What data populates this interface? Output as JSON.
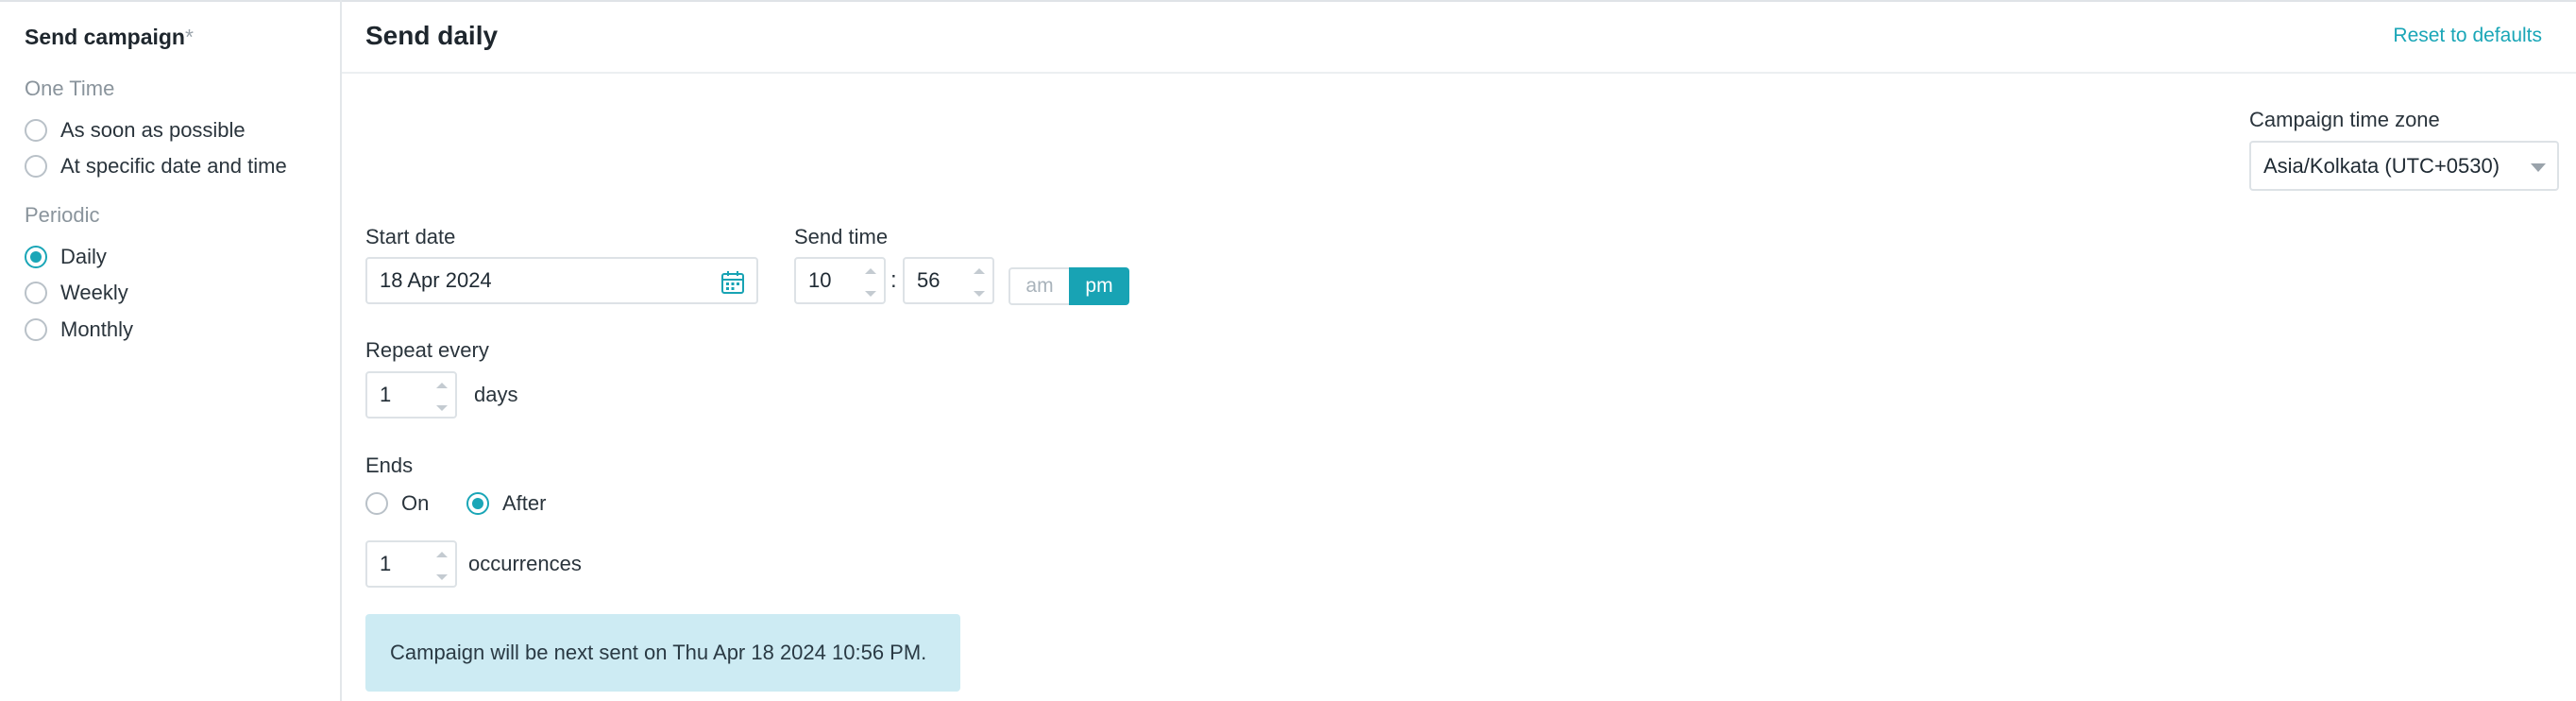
{
  "sidebar": {
    "title": "Send campaign",
    "required_mark": "*",
    "one_time_label": "One Time",
    "periodic_label": "Periodic",
    "options": [
      {
        "label": "As soon as possible",
        "selected": false
      },
      {
        "label": "At specific date and time",
        "selected": false
      },
      {
        "label": "Daily",
        "selected": true
      },
      {
        "label": "Weekly",
        "selected": false
      },
      {
        "label": "Monthly",
        "selected": false
      }
    ]
  },
  "header": {
    "title": "Send daily",
    "reset_label": "Reset to defaults"
  },
  "timezone": {
    "label": "Campaign time zone",
    "value": "Asia/Kolkata (UTC+0530)"
  },
  "start_date": {
    "label": "Start date",
    "value": "18 Apr 2024",
    "icon": "calendar-icon"
  },
  "send_time": {
    "label": "Send time",
    "hour": "10",
    "separator": ":",
    "minute": "56",
    "am_label": "am",
    "pm_label": "pm",
    "selected_period": "pm"
  },
  "repeat": {
    "label": "Repeat every",
    "value": "1",
    "unit": "days"
  },
  "ends": {
    "label": "Ends",
    "on_label": "On",
    "after_label": "After",
    "selected": "After",
    "occurrences_value": "1",
    "occurrences_unit": "occurrences"
  },
  "info_message": "Campaign will be next sent on Thu Apr 18 2024 10:56 PM.",
  "colors": {
    "accent": "#18a3b4",
    "info_bg": "#cdebf3",
    "border": "#dde2e6"
  }
}
